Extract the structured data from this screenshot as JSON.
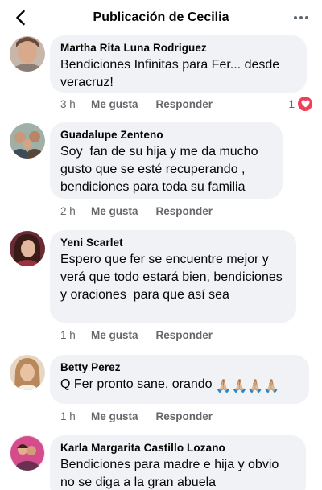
{
  "header": {
    "title": "Publicación de Cecilia"
  },
  "comments": [
    {
      "author": "Martha Rita Luna Rodriguez",
      "text": "Bendiciones Infinitas para Fer... desde veracruz!",
      "time": "3 h",
      "like_label": "Me gusta",
      "reply_label": "Responder",
      "reaction_count": "1",
      "reaction_icon": "heart-icon"
    },
    {
      "author": "Guadalupe Zenteno",
      "text": "Soy  fan de su hija y me da mucho gusto que se esté recuperando , bendiciones para toda su familia",
      "time": "2 h",
      "like_label": "Me gusta",
      "reply_label": "Responder"
    },
    {
      "author": "Yeni Scarlet",
      "text": "Espero que fer se encuentre mejor y verá que todo estará bien, bendiciones y oraciones  para que así sea",
      "time": "1 h",
      "like_label": "Me gusta",
      "reply_label": "Responder"
    },
    {
      "author": "Betty Perez",
      "text": "Q Fer pronto sane, orando",
      "emoji": "🙏🏼🙏🏼🙏🏼🙏🏼",
      "time": "1 h",
      "like_label": "Me gusta",
      "reply_label": "Responder"
    },
    {
      "author": "Karla Margarita Castillo Lozano",
      "text": "Bendiciones para madre e hija y obvio no se diga a la gran abuela"
    }
  ],
  "colors": {
    "bubble": "#f0f2f5",
    "meta_text": "#65676b",
    "heart": "#f33e58"
  }
}
